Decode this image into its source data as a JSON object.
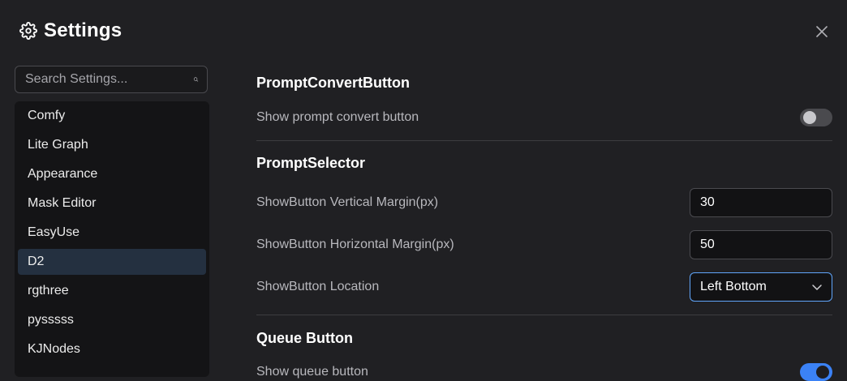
{
  "header": {
    "title": "Settings",
    "icon": "gear-icon",
    "close_icon": "close-icon"
  },
  "search": {
    "placeholder": "Search Settings...",
    "value": "",
    "icon": "search-icon"
  },
  "sidebar": {
    "items": [
      {
        "label": "Comfy"
      },
      {
        "label": "Lite Graph"
      },
      {
        "label": "Appearance"
      },
      {
        "label": "Mask Editor"
      },
      {
        "label": "EasyUse"
      },
      {
        "label": "D2",
        "active": true
      },
      {
        "label": "rgthree"
      },
      {
        "label": "pysssss"
      },
      {
        "label": "KJNodes"
      }
    ]
  },
  "main": {
    "sections": [
      {
        "title": "PromptConvertButton",
        "settings": [
          {
            "label": "Show prompt convert button",
            "type": "toggle",
            "value": false
          }
        ]
      },
      {
        "title": "PromptSelector",
        "settings": [
          {
            "label": "ShowButton Vertical Margin(px)",
            "type": "number",
            "value": "30"
          },
          {
            "label": "ShowButton Horizontal Margin(px)",
            "type": "number",
            "value": "50"
          },
          {
            "label": "ShowButton Location",
            "type": "select",
            "value": "Left Bottom"
          }
        ]
      },
      {
        "title": "Queue Button",
        "settings": [
          {
            "label": "Show queue button",
            "type": "toggle",
            "value": true
          }
        ]
      }
    ]
  },
  "colors": {
    "accent": "#3b82f6",
    "background": "#202023",
    "sidebar_bg": "#141416",
    "active_item_bg": "#243040"
  }
}
